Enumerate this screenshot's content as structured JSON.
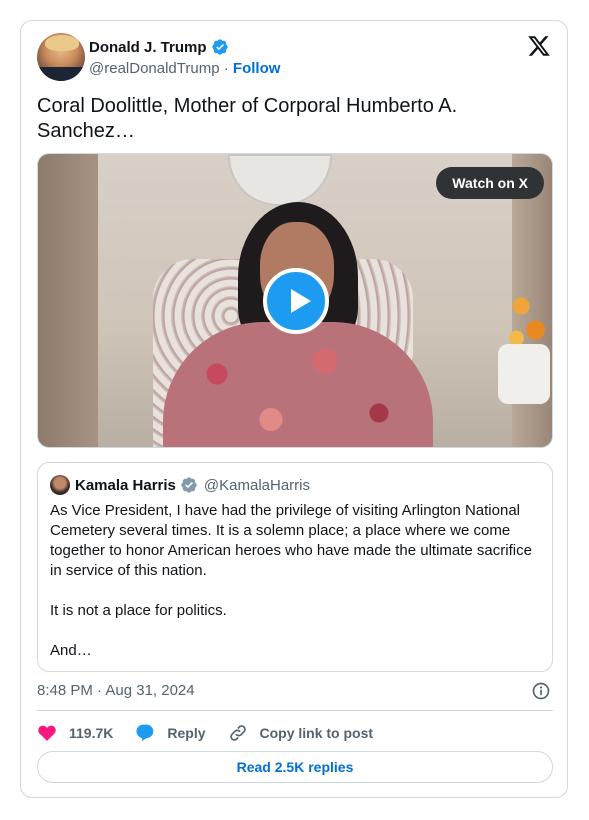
{
  "author": {
    "name": "Donald J. Trump",
    "handle": "@realDonaldTrump",
    "separator": "·",
    "follow_label": "Follow"
  },
  "tweet": {
    "text": "Coral Doolittle, Mother of Corporal Humberto A. Sanchez…"
  },
  "media": {
    "watch_label": "Watch on X"
  },
  "quoted_tweet": {
    "name": "Kamala Harris",
    "handle": "@KamalaHarris",
    "paragraphs": [
      "As Vice President, I have had the privilege of visiting Arlington National Cemetery several times. It is a solemn place; a place where we come together to honor American heroes who have made the ultimate sacrifice in service of this nation.",
      "It is not a place for politics.",
      "And…"
    ]
  },
  "meta": {
    "timestamp": "8:48 PM · Aug 31, 2024"
  },
  "actions": {
    "likes": "119.7K",
    "reply_label": "Reply",
    "copy_link_label": "Copy link to post"
  },
  "footer": {
    "read_replies_label": "Read 2.5K replies"
  },
  "colors": {
    "accent_blue": "#1d9bf0",
    "link_blue": "#006fd6",
    "like_pink": "#f91880",
    "text_dark": "#0f1419",
    "text_gray": "#536471",
    "border": "#cfd9de"
  },
  "icons": {
    "verified": "verified-badge-icon",
    "gray_verified": "gray-verified-badge-icon",
    "x_logo": "x-logo-icon",
    "play": "play-icon",
    "info": "info-icon",
    "heart": "heart-icon",
    "reply": "reply-bubble-icon",
    "link": "link-icon"
  }
}
